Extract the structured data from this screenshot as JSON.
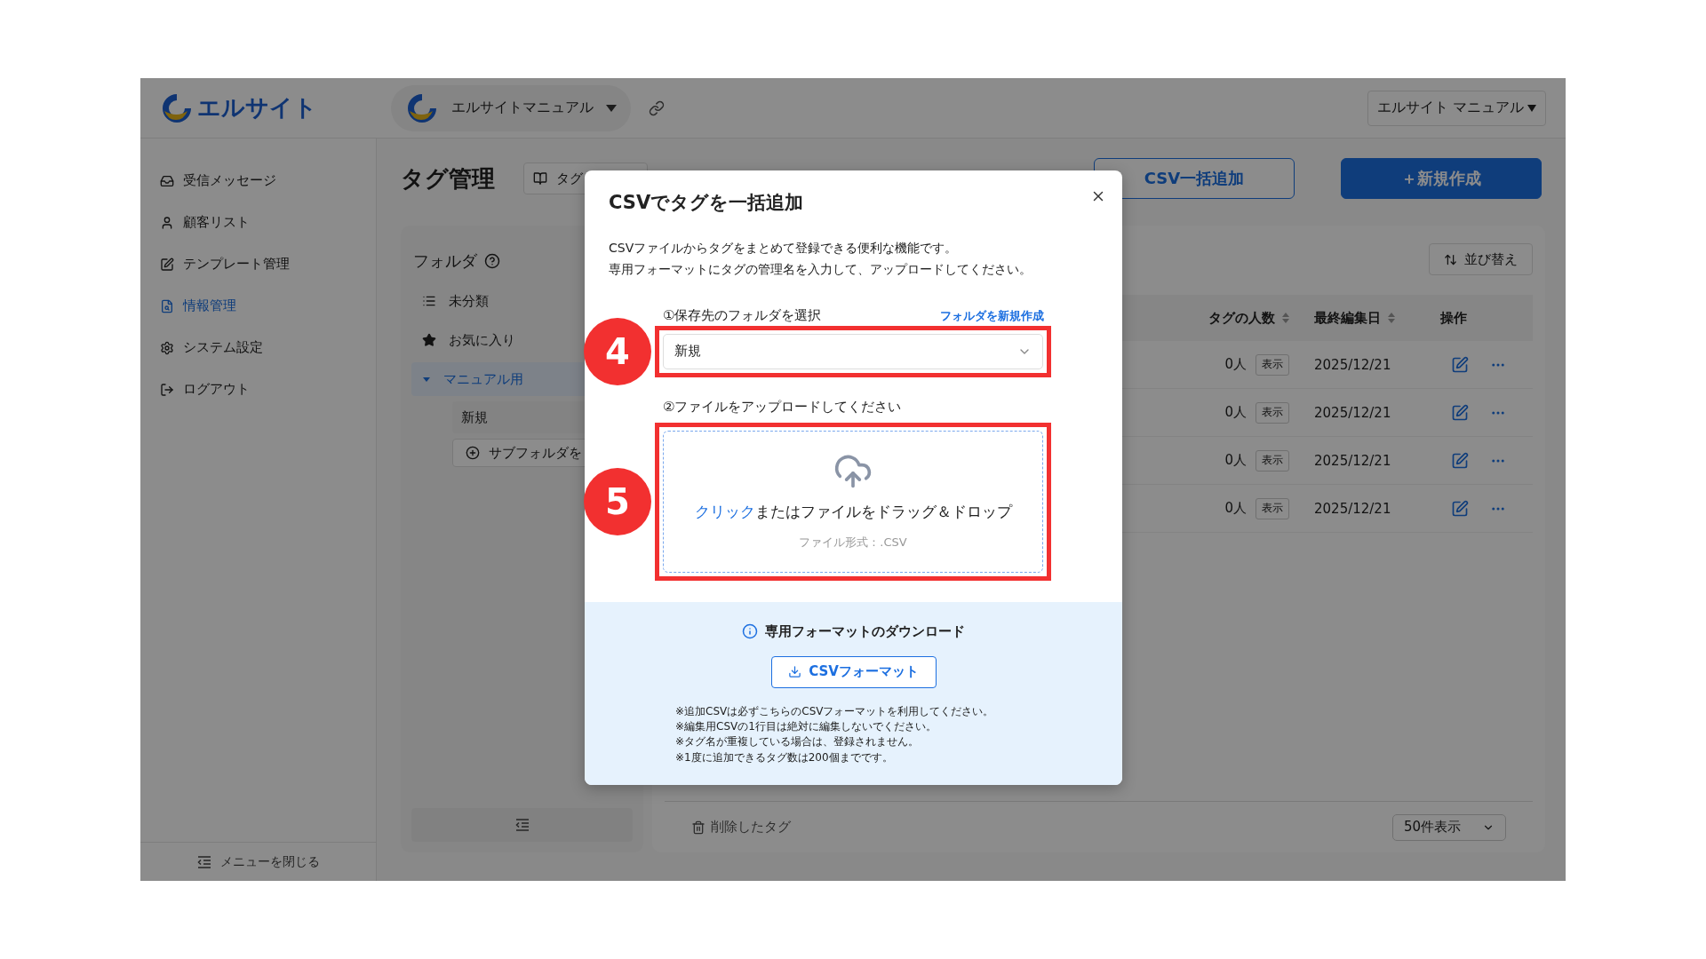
{
  "header": {
    "logo": "エルサイト",
    "workspace": "エルサイトマニュアル",
    "account": "エルサイト マニュアル"
  },
  "sidebar": {
    "items": [
      {
        "label": "受信メッセージ",
        "selected": false
      },
      {
        "label": "顧客リスト",
        "selected": false
      },
      {
        "label": "テンプレート管理",
        "selected": false
      },
      {
        "label": "情報管理",
        "selected": true
      },
      {
        "label": "システム設定",
        "selected": false
      },
      {
        "label": "ログアウト",
        "selected": false
      }
    ],
    "close_label": "メニューを閉じる"
  },
  "page": {
    "title": "タグ管理",
    "guide_button": "タグ",
    "actions": [
      {
        "label": "CSV一括追加",
        "kind": "outline"
      },
      {
        "label": "＋新規作成",
        "kind": "primary"
      }
    ]
  },
  "folders": {
    "title": "フォルダ",
    "items": [
      {
        "label": "未分類",
        "selected": false
      },
      {
        "label": "お気に入り",
        "selected": false
      },
      {
        "label": "マニュアル用",
        "selected": true,
        "expanded": true,
        "children": [
          {
            "label": "新規"
          }
        ]
      }
    ],
    "add_subfolder": "サブフォルダを"
  },
  "table": {
    "sort_button": "並び替え",
    "columns": [
      {
        "label": "タグの人数",
        "sortable": true
      },
      {
        "label": "最終編集日",
        "sortable": true
      },
      {
        "label": "操作",
        "sortable": false
      }
    ],
    "rows": [
      {
        "count": "0人",
        "view": "表示",
        "date": "2025/12/21"
      },
      {
        "count": "0人",
        "view": "表示",
        "date": "2025/12/21"
      },
      {
        "count": "0人",
        "view": "表示",
        "date": "2025/12/21"
      },
      {
        "count": "0人",
        "view": "表示",
        "date": "2025/12/21"
      }
    ],
    "deleted_link": "削除したタグ",
    "page_size": "50件表示"
  },
  "modal": {
    "title": "CSVでタグを一括追加",
    "description": [
      "CSVファイルからタグをまとめて登録できる便利な機能です。",
      "専用フォーマットにタグの管理名を入力して、アップロードしてください。"
    ],
    "folder_step": "4",
    "folder_label": "①保存先のフォルダを選択",
    "new_folder_link": "フォルダを新規作成",
    "folder_value": "新規",
    "upload_step": "5",
    "upload_label": "②ファイルをアップロードしてください",
    "drop_link": "クリック",
    "drop_text": "またはファイルをドラッグ＆ドロップ",
    "file_format": "ファイル形式：.CSV",
    "download_title": "専用フォーマットのダウンロード",
    "download_button": "CSVフォーマット",
    "notes": [
      "※追加CSVは必ずこちらのCSVフォーマットを利用してください。",
      "※編集用CSVの1行目は絶対に編集しないでください。",
      "※タグ名が重複している場合は、登録されません。",
      "※1度に追加できるタグ数は200個までです。"
    ]
  }
}
